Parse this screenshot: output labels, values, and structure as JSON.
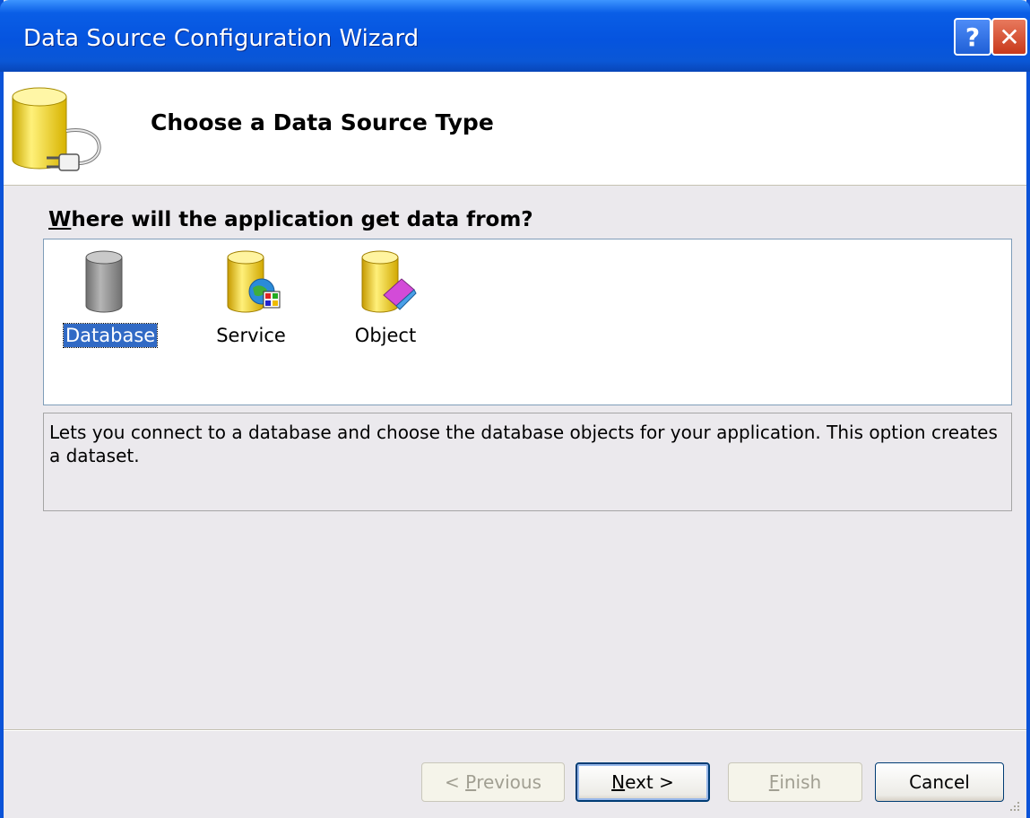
{
  "window": {
    "title": "Data Source Configuration Wizard",
    "help_label": "?",
    "close_label": "✕"
  },
  "header": {
    "title": "Choose a Data Source Type",
    "icon": "database-plug-icon"
  },
  "question": {
    "mnemonic": "W",
    "rest": "here will the application get data from?"
  },
  "source_types": [
    {
      "label": "Database",
      "icon": "database-icon",
      "selected": true
    },
    {
      "label": "Service",
      "icon": "service-icon",
      "selected": false
    },
    {
      "label": "Object",
      "icon": "object-icon",
      "selected": false
    }
  ],
  "description": "Lets you connect to a database and choose the database objects for your application. This option creates a dataset.",
  "buttons": {
    "previous": {
      "prefix": "< ",
      "mnemonic": "P",
      "rest": "revious",
      "enabled": false
    },
    "next": {
      "mnemonic": "N",
      "rest": "ext >",
      "enabled": true
    },
    "finish": {
      "mnemonic": "F",
      "rest": "inish",
      "enabled": false
    },
    "cancel": {
      "label": "Cancel",
      "enabled": true
    }
  },
  "colors": {
    "titlebar": "#0554df",
    "selection": "#316ac5",
    "dialog_bg": "#ebe9ed"
  }
}
